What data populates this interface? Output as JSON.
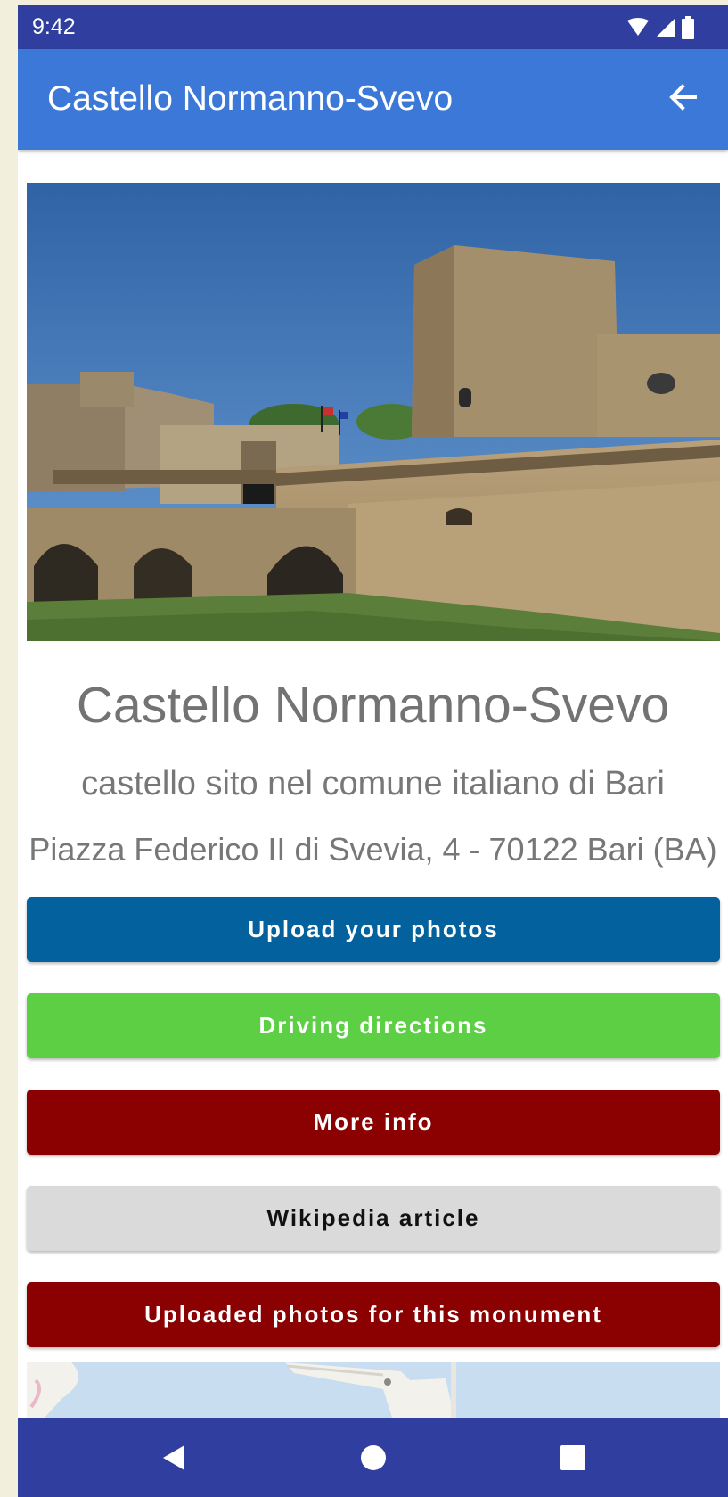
{
  "status_bar": {
    "time": "9:42",
    "icons": [
      "wifi-icon",
      "signal-icon",
      "battery-icon"
    ]
  },
  "app_bar": {
    "title": "Castello Normanno-Svevo",
    "back_icon": "arrow-back-icon"
  },
  "monument": {
    "name": "Castello Normanno-Svevo",
    "description": "castello sito nel comune italiano di Bari",
    "address": "Piazza Federico II di Svevia, 4 - 70122 Bari (BA)"
  },
  "buttons": {
    "upload": "Upload your photos",
    "driving": "Driving directions",
    "more_info": "More info",
    "wikipedia": "Wikipedia article",
    "uploaded_photos": "Uploaded photos for this monument"
  },
  "colors": {
    "status_bar": "#303f9f",
    "app_bar": "#3c78d8",
    "upload_button": "#03629e",
    "driving_button": "#5ccf45",
    "more_info_button": "#8b0000",
    "wikipedia_button": "#dadada",
    "uploaded_button": "#8b0000"
  },
  "nav_bar": {
    "icons": [
      "back-triangle-icon",
      "home-circle-icon",
      "recents-square-icon"
    ]
  }
}
